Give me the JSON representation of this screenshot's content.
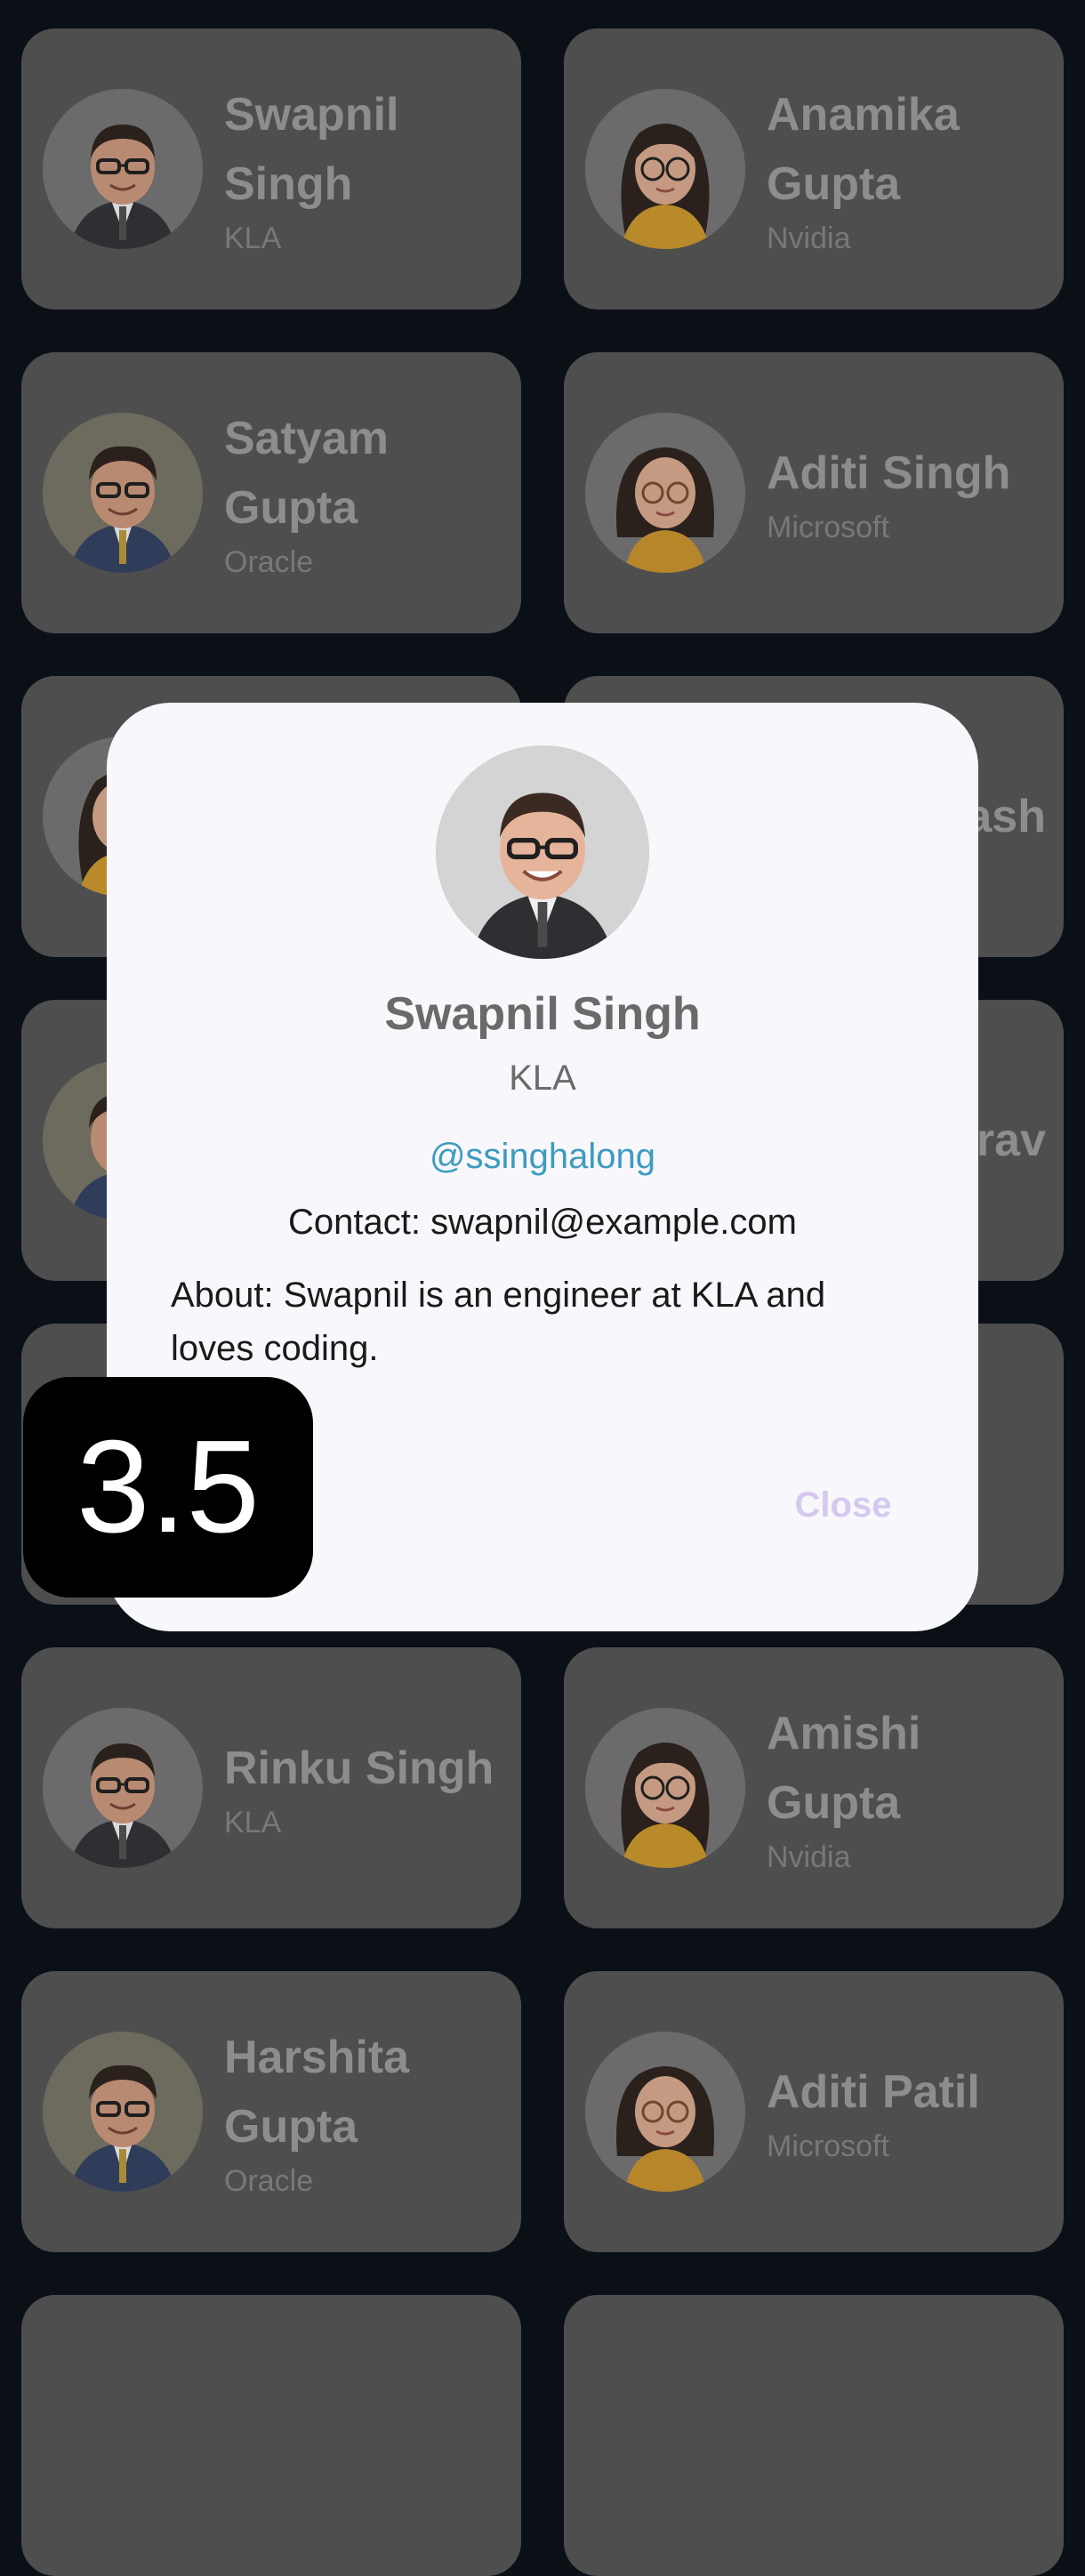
{
  "cards": [
    {
      "name": "Swapnil Singh",
      "company": "KLA",
      "avatar": "man-glasses-suit-avatar"
    },
    {
      "name": "Anamika Gupta",
      "company": "Nvidia",
      "avatar": "woman-glasses-scarf-avatar"
    },
    {
      "name": "Satyam Gupta",
      "company": "Oracle",
      "avatar": "man-glasses-blue-suit-avatar"
    },
    {
      "name": "Aditi Singh",
      "company": "Microsoft",
      "avatar": "woman-round-glasses-avatar"
    },
    {
      "name": "",
      "company": "",
      "avatar": "woman-glasses-scarf-avatar"
    },
    {
      "name": "ash",
      "company": "",
      "avatar": ""
    },
    {
      "name": "",
      "company": "",
      "avatar": "man-glasses-blue-suit-avatar"
    },
    {
      "name": "urav",
      "company": "",
      "avatar": ""
    },
    {
      "name": "",
      "company": "",
      "avatar": ""
    },
    {
      "name": "",
      "company": "",
      "avatar": ""
    },
    {
      "name": "Rinku Singh",
      "company": "KLA",
      "avatar": "man-glasses-suit-avatar"
    },
    {
      "name": "Amishi Gupta",
      "company": "Nvidia",
      "avatar": "woman-glasses-scarf-avatar"
    },
    {
      "name": "Harshita Gupta",
      "company": "Oracle",
      "avatar": "man-glasses-blue-suit-avatar"
    },
    {
      "name": "Aditi Patil",
      "company": "Microsoft",
      "avatar": "woman-round-glasses-avatar"
    },
    {
      "name": "",
      "company": "",
      "avatar": ""
    },
    {
      "name": "",
      "company": "",
      "avatar": ""
    }
  ],
  "dialog": {
    "name": "Swapnil Singh",
    "company": "KLA",
    "handle": "@ssinghalong",
    "contact": "Contact: swapnil@example.com",
    "about": "About: Swapnil is an engineer at KLA and loves coding.",
    "close_label": "Close"
  },
  "badge": {
    "value": "3.5"
  },
  "colors": {
    "background": "#0b1017",
    "card": "#4e4e4e",
    "dialog": "#f8f7fc",
    "link": "#3d9bc1",
    "close": "#d6c9f0"
  }
}
